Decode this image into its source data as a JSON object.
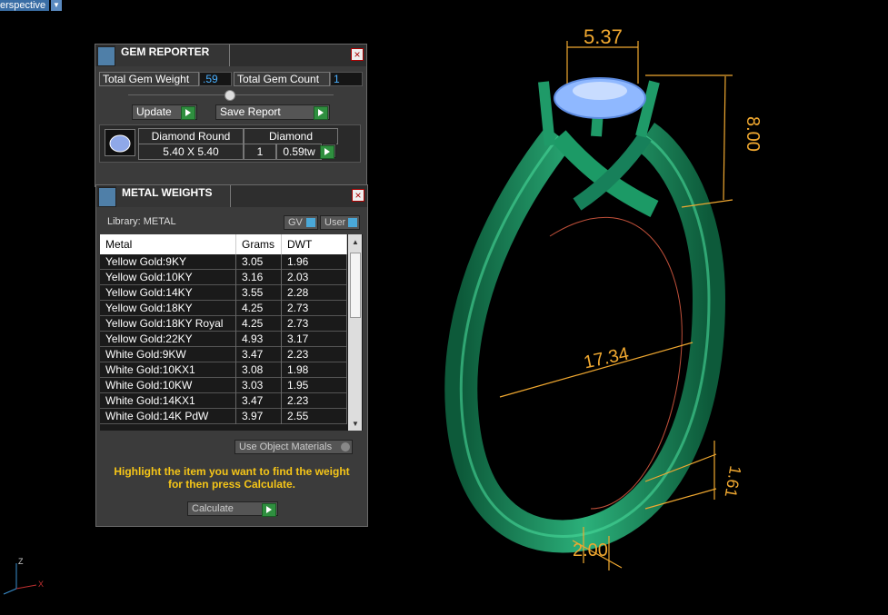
{
  "viewport": {
    "label": "erspective"
  },
  "gem_reporter": {
    "title": "GEM REPORTER",
    "total_weight_label": "Total Gem Weight",
    "total_weight_value": ".59",
    "total_count_label": "Total Gem Count",
    "total_count_value": "1",
    "update_label": "Update",
    "save_report_label": "Save Report",
    "gem": {
      "name": "Diamond Round",
      "size": "5.40 X 5.40",
      "material": "Diamond",
      "count": "1",
      "weight": "0.59tw"
    }
  },
  "metal_weights": {
    "title": "METAL WEIGHTS",
    "library_label": "Library: METAL",
    "gv_label": "GV",
    "user_label": "User",
    "columns": [
      "Metal",
      "Grams",
      "DWT"
    ],
    "rows": [
      [
        "Yellow Gold:9KY",
        "3.05",
        "1.96"
      ],
      [
        "Yellow Gold:10KY",
        "3.16",
        "2.03"
      ],
      [
        "Yellow Gold:14KY",
        "3.55",
        "2.28"
      ],
      [
        "Yellow Gold:18KY",
        "4.25",
        "2.73"
      ],
      [
        "Yellow Gold:18KY Royal",
        "4.25",
        "2.73"
      ],
      [
        "Yellow Gold:22KY",
        "4.93",
        "3.17"
      ],
      [
        "White Gold:9KW",
        "3.47",
        "2.23"
      ],
      [
        "White Gold:10KX1",
        "3.08",
        "1.98"
      ],
      [
        "White Gold:10KW",
        "3.03",
        "1.95"
      ],
      [
        "White Gold:14KX1",
        "3.47",
        "2.23"
      ],
      [
        "White Gold:14K PdW",
        "3.97",
        "2.55"
      ]
    ],
    "use_object_materials_label": "Use Object Materials",
    "hint": "Highlight the item you want to find the weight for then press Calculate.",
    "calculate_label": "Calculate"
  },
  "dimensions": {
    "top_width": "5.37",
    "height": "8.00",
    "inner_diameter": "17.34",
    "band_thickness": "1.61",
    "band_width": "2.00"
  },
  "axis": {
    "z": "Z",
    "x": "X"
  },
  "colors": {
    "ring": "#1f8a5c",
    "dimension": "#f0a830",
    "hint": "#f5c518",
    "gem": "#8fb8ff"
  }
}
